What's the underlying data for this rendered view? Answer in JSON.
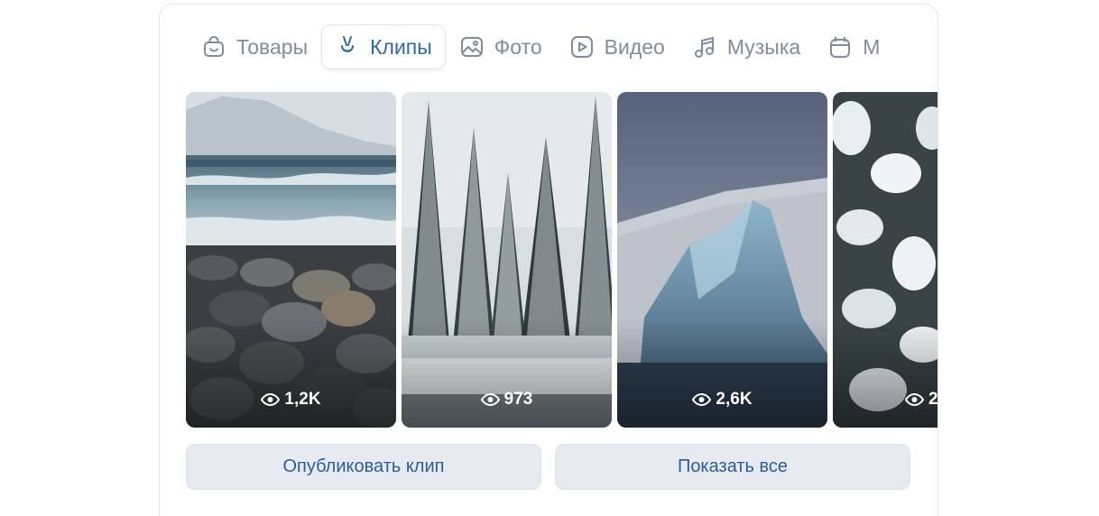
{
  "tabs": [
    {
      "label": "Товары",
      "icon": "shopping-bag-icon",
      "active": false
    },
    {
      "label": "Клипы",
      "icon": "clips-icon",
      "active": true
    },
    {
      "label": "Фото",
      "icon": "photo-icon",
      "active": false
    },
    {
      "label": "Видео",
      "icon": "video-play-icon",
      "active": false
    },
    {
      "label": "Музыка",
      "icon": "music-note-icon",
      "active": false
    },
    {
      "label": "М",
      "icon": "calendar-icon",
      "active": false
    }
  ],
  "clips": [
    {
      "views": "1,2K",
      "scene": "rocky shore with waves"
    },
    {
      "views": "973",
      "scene": "snowy spruce forest"
    },
    {
      "views": "2,6K",
      "scene": "blue ice block"
    },
    {
      "views": "2",
      "scene": "snow covered branches"
    }
  ],
  "actions": {
    "publish_label": "Опубликовать клип",
    "show_all_label": "Показать все"
  },
  "colors": {
    "accent": "#2d68b0",
    "tab_inactive": "#818c99",
    "button_bg": "#e6ebf1",
    "button_text": "#2c5d94"
  }
}
